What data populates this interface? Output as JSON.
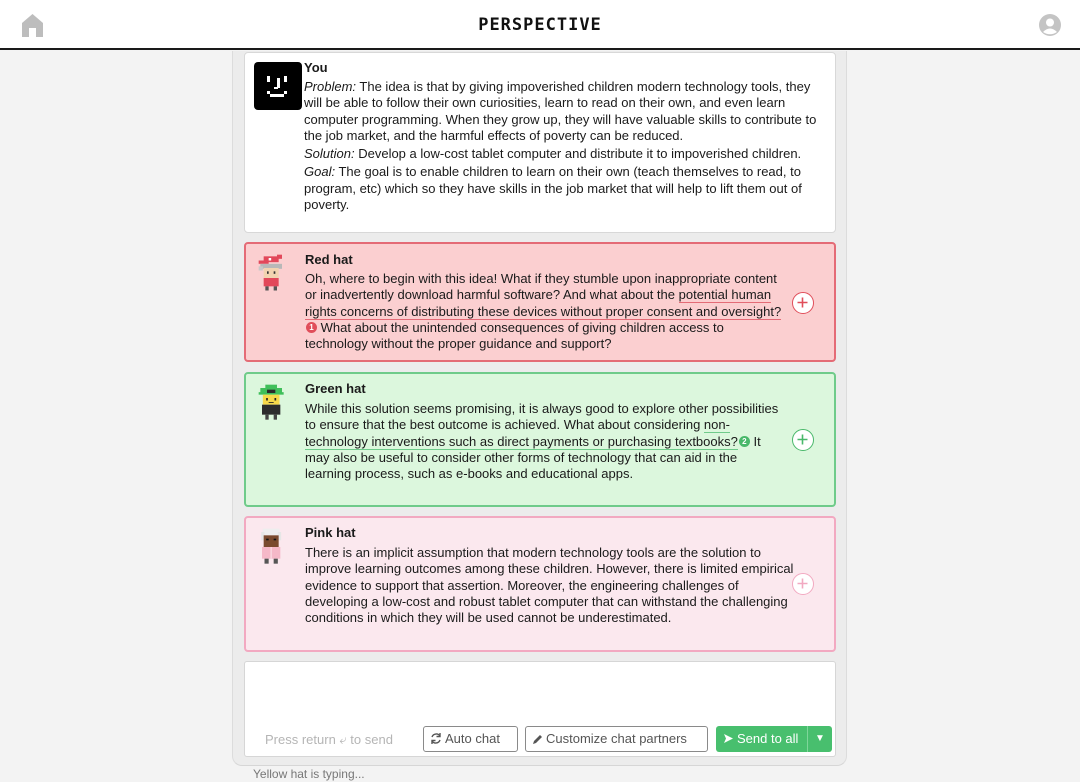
{
  "header": {
    "title": "PERSPECTIVE",
    "home_icon": "home-icon",
    "user_icon": "user-account-icon"
  },
  "messages": [
    {
      "author": "You",
      "avatar": "smiley-face-avatar",
      "problem_label": "Problem:",
      "problem_text": "The idea is that by giving impoverished children modern technology tools, they will be able to follow their own curiosities, learn to read on their own, and even learn computer programming. When they grow up, they will have valuable skills to contribute to the job market, and the harmful effects of poverty can be reduced.",
      "solution_label": "Solution:",
      "solution_text": "Develop a low-cost tablet computer and distribute it to impoverished children.",
      "goal_label": "Goal:",
      "goal_text": "The goal is to enable children to learn on their own (teach themselves to read, to program, etc) which so they have skills in the job market that will help to lift them out of poverty."
    },
    {
      "author": "Red hat",
      "avatar": "red-hat-character-avatar",
      "text_before": "Oh, where to begin with this idea! What if they stumble upon inappropriate content or inadvertently download harmful software? And what about the ",
      "highlight": "potential human rights concerns of distributing these devices without proper consent and oversight?",
      "badge": "1",
      "text_after": " What about the unintended consequences of giving children access to technology without the proper guidance and support?",
      "color": "#e46b76"
    },
    {
      "author": "Green hat",
      "avatar": "green-hat-character-avatar",
      "text_before": "While this solution seems promising, it is always good to explore other possibilities to ensure that the best outcome is achieved. What about considering ",
      "highlight": "non-technology interventions such as direct payments or purchasing textbooks?",
      "badge": "2",
      "text_after": " It may also be useful to consider other forms of technology that can aid in the learning process, such as e-books and educational apps.",
      "color": "#6fcb8a"
    },
    {
      "author": "Pink hat",
      "avatar": "pink-hat-character-avatar",
      "text": "There is an implicit assumption that modern technology tools are the solution to improve learning outcomes among these children. However, there is limited empirical evidence to support that assertion. Moreover, the engineering challenges of developing a low-cost and robust tablet computer that can withstand the challenging conditions in which they will be used cannot be underestimated.",
      "color": "#f2a9c1"
    }
  ],
  "composer": {
    "value": "",
    "hint": "Press return ⤶ to send",
    "auto_chat_label": "Auto chat",
    "customize_label": "Customize chat partners",
    "send_label": "Send to all",
    "send_caret": "▼",
    "send_color": "#48bf6e"
  },
  "status": {
    "typing": "Yellow hat is typing..."
  }
}
